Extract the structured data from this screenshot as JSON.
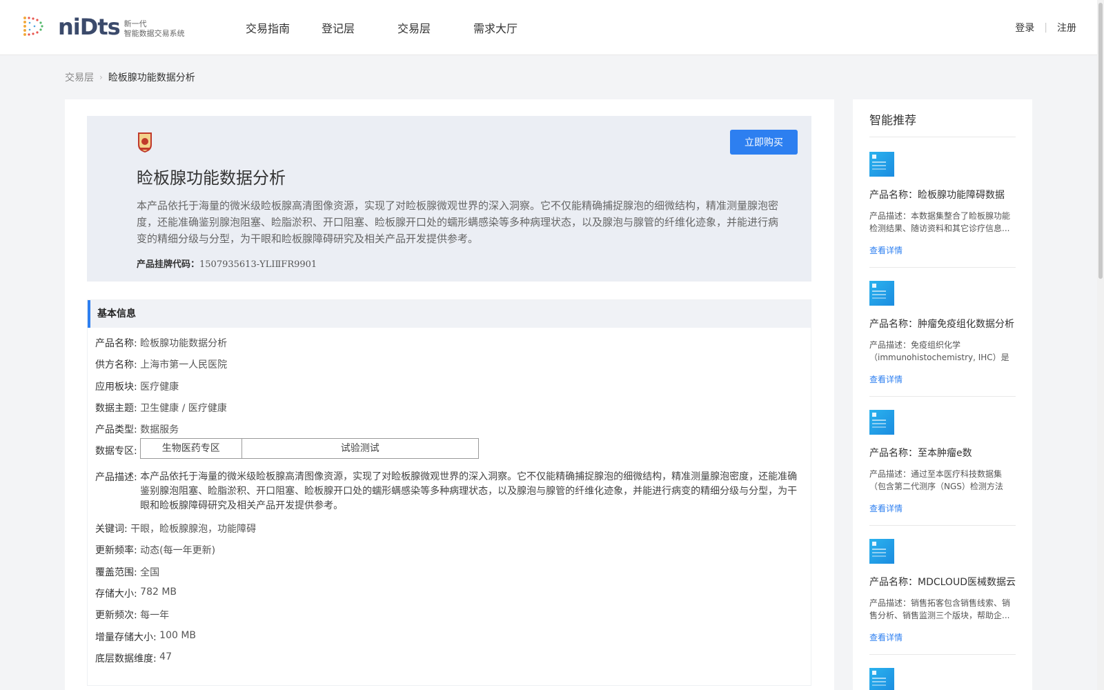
{
  "header": {
    "logo_word": "niDts",
    "logo_sub_1": "新一代",
    "logo_sub_2": "智能数据交易系统",
    "nav": [
      "交易指南",
      "登记层",
      "交易层",
      "需求大厅"
    ],
    "login": "登录",
    "register": "注册"
  },
  "breadcrumb": {
    "parent": "交易层",
    "current": "睑板腺功能数据分析"
  },
  "hero": {
    "title": "睑板腺功能数据分析",
    "description": "本产品依托于海量的微米级睑板腺高清图像资源，实现了对睑板腺微观世界的深入洞察。它不仅能精确捕捉腺泡的细微结构，精准测量腺泡密度，还能准确鉴别腺泡阻塞、睑脂淤积、开口阻塞、睑板腺开口处的蠕形螨感染等多种病理状态，以及腺泡与腺管的纤维化迹象，并能进行病变的精细分级与分型，为干眼和睑板腺障碍研究及相关产品开发提供参考。",
    "code_label": "产品挂牌代码：",
    "code_value": "1507935613-YLIⅡFR9901",
    "buy_label": "立即购买"
  },
  "info": {
    "heading": "基本信息",
    "product_name_k": "产品名称:",
    "product_name_v": "睑板腺功能数据分析",
    "supplier_k": "供方名称:",
    "supplier_v": "上海市第一人民医院",
    "sector_k": "应用板块:",
    "sector_v": "医疗健康",
    "theme_k": "数据主题:",
    "theme_v": "卫生健康 / 医疗健康",
    "type_k": "产品类型:",
    "type_v": "数据服务",
    "zone_k": "数据专区:",
    "zones": [
      "生物医药专区",
      "试验测试"
    ],
    "desc_k": "产品描述:",
    "desc_v": "本产品依托于海量的微米级睑板腺高清图像资源，实现了对睑板腺微观世界的深入洞察。它不仅能精确捕捉腺泡的细微结构，精准测量腺泡密度，还能准确鉴别腺泡阻塞、睑脂淤积、开口阻塞、睑板腺开口处的蠕形螨感染等多种病理状态，以及腺泡与腺管的纤维化迹象，并能进行病变的精细分级与分型，为干眼和睑板腺障碍研究及相关产品开发提供参考。",
    "keywords_k": "关键词:",
    "keywords_v": "干眼，睑板腺腺泡，功能障碍",
    "freq_k": "更新频率:",
    "freq_v": "动态(每一年更新)",
    "coverage_k": "覆盖范围:",
    "coverage_v": "全国",
    "size_k": "存储大小:",
    "size_v": "782 MB",
    "times_k": "更新频次:",
    "times_v": "每一年",
    "inc_k": "增量存储大小:",
    "inc_v": "100 MB",
    "dim_k": "底层数据维度:",
    "dim_v": "47"
  },
  "sidebar": {
    "title": "智能推荐",
    "link_label": "查看详情",
    "items": [
      {
        "name": "产品名称：睑板腺功能障碍数据",
        "desc": "产品描述：本数据集整合了睑板腺功能检测结果、随访资料和其它诊疗信息..."
      },
      {
        "name": "产品名称：肿瘤免疫组化数据分析",
        "desc": "产品描述：免疫组织化学（immunohistochemistry, IHC）是利..."
      },
      {
        "name": "产品名称：至本肿瘤e数",
        "desc": "产品描述：通过至本医疗科技数据集（包含第二代测序（NGS）检测方法检..."
      },
      {
        "name": "产品名称：MDCLOUD医械数据云-销售",
        "desc": "产品描述：销售拓客包含销售线索、销售分析、销售监测三个版块，帮助企..."
      }
    ]
  }
}
